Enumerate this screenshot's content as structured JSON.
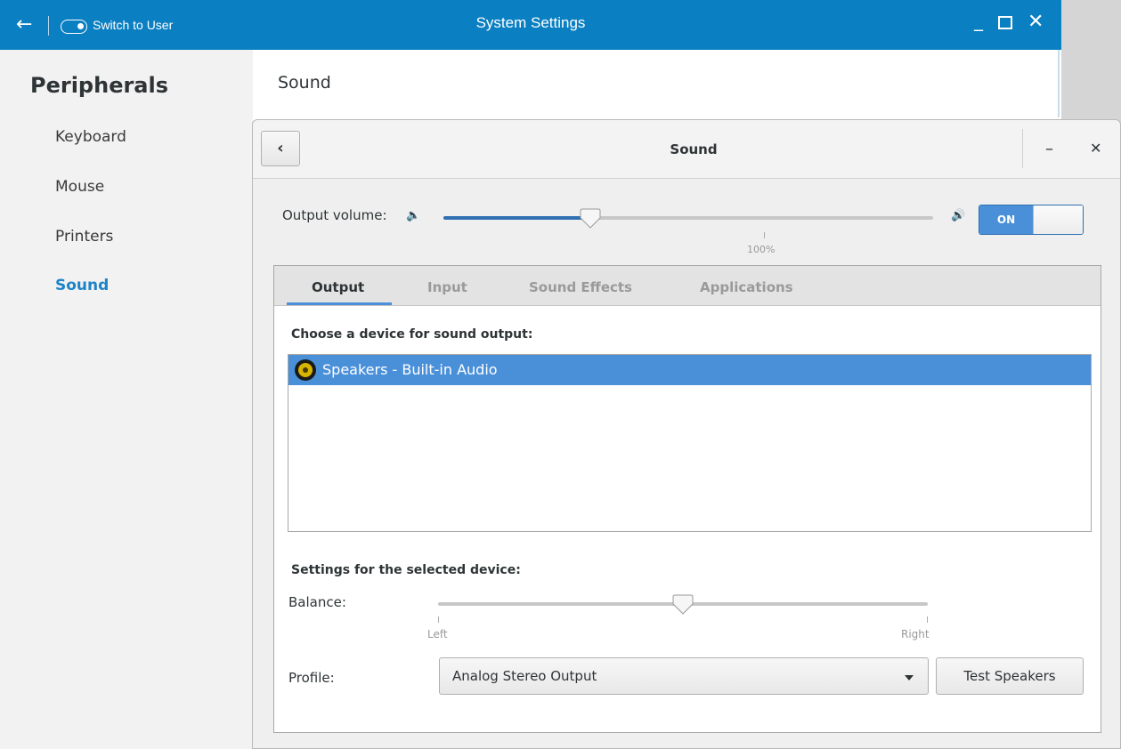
{
  "topbar": {
    "switch_label": "Switch to User",
    "title": "System Settings",
    "accent": "#0a7fc1"
  },
  "sidebar": {
    "heading": "Peripherals",
    "items": [
      {
        "label": "Keyboard",
        "active": false
      },
      {
        "label": "Mouse",
        "active": false
      },
      {
        "label": "Printers",
        "active": false
      },
      {
        "label": "Sound",
        "active": true
      }
    ]
  },
  "main": {
    "title": "Sound"
  },
  "dialog": {
    "title": "Sound",
    "output_volume": {
      "label": "Output volume:",
      "level_fraction": 0.3,
      "mark_label": "100%",
      "toggle_label": "ON"
    },
    "tabs": [
      {
        "label": "Output",
        "active": true
      },
      {
        "label": "Input",
        "active": false
      },
      {
        "label": "Sound Effects",
        "active": false
      },
      {
        "label": "Applications",
        "active": false
      }
    ],
    "choose_label": "Choose a device for sound output:",
    "devices": [
      {
        "name": "Speakers - Built-in Audio",
        "selected": true,
        "icon": "speaker-icon"
      }
    ],
    "settings_label": "Settings for the selected device:",
    "balance": {
      "label": "Balance:",
      "level_fraction": 0.5,
      "left_label": "Left",
      "right_label": "Right"
    },
    "profile": {
      "label": "Profile:",
      "value": "Analog Stereo Output"
    },
    "test_button": "Test Speakers"
  },
  "colors": {
    "selection": "#4a90d9",
    "active_sidebar": "#1d84c7"
  }
}
